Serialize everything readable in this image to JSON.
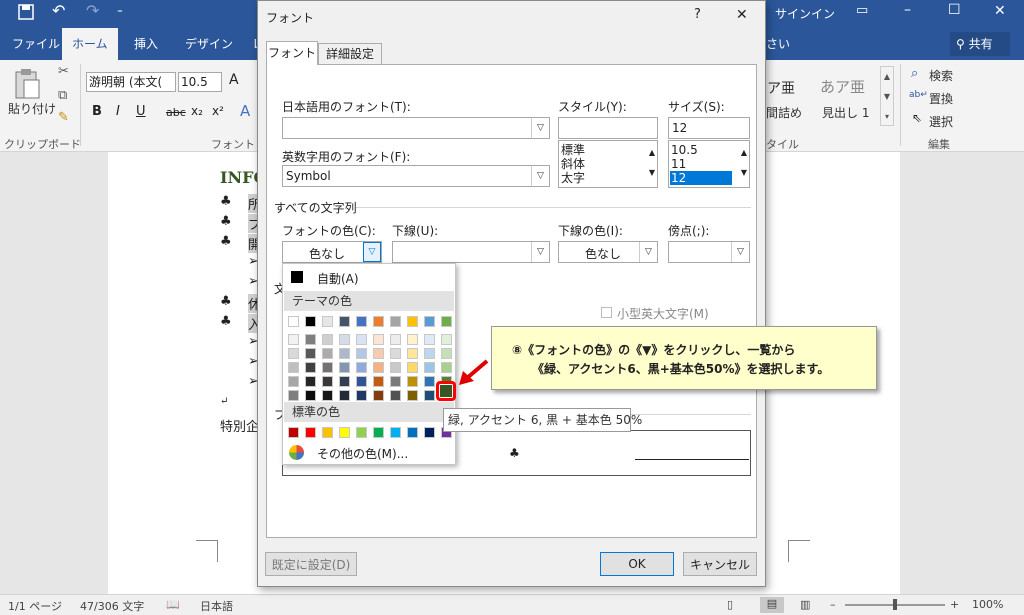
{
  "window": {
    "signin": "サインイン",
    "share": "共有",
    "help_hint": "さい"
  },
  "tabs": [
    "ファイル",
    "ホーム",
    "挿入",
    "デザイン",
    "レ"
  ],
  "ribbon": {
    "paste": "貼り付け",
    "clipboard": "クリップボード",
    "font_group": "フォント",
    "font_name": "游明朝 (本文(",
    "font_size": "10.5",
    "style1_preview": "ア亜",
    "style1_name": "間詰め",
    "style2_preview": "あア亜",
    "style2_name": "見出し 1",
    "style_group": "タイル",
    "find": "検索",
    "replace": "置換",
    "select": "選択",
    "edit_group": "編集"
  },
  "doc": {
    "heading": "INFO",
    "bullet_chars": [
      "♣",
      "♣",
      "♣",
      "➢",
      "➢",
      "♣",
      "♣",
      "➢",
      "➢",
      "➢"
    ],
    "frag1": "所",
    "frag2": "プ",
    "frag3": "開",
    "frag4": "休",
    "frag5": "入",
    "return": "↵",
    "special": "特別企"
  },
  "status": {
    "page": "1/1 ページ",
    "words": "47/306 文字",
    "lang": "日本語",
    "zoom": "100%"
  },
  "dialog": {
    "title": "フォント",
    "help": "?",
    "close": "✕",
    "tab_font": "フォント",
    "tab_advanced": "詳細設定",
    "jp_font_label": "日本語用のフォント(T):",
    "jp_font_value": "",
    "en_font_label": "英数字用のフォント(F):",
    "en_font_value": "Symbol",
    "style_label": "スタイル(Y):",
    "style_value": "",
    "style_options": [
      "標準",
      "斜体",
      "太字"
    ],
    "size_label": "サイズ(S):",
    "size_value": "12",
    "size_options": [
      "10.5",
      "11",
      "12"
    ],
    "all_text_label": "すべての文字列",
    "font_color_label": "フォントの色(C):",
    "font_color_value": "色なし",
    "underline_label": "下線(U):",
    "underline_value": "",
    "underline_color_label": "下線の色(I):",
    "underline_color_value": "色なし",
    "emphasis_label": "傍点(;):",
    "emphasis_value": "",
    "effects_label": "文",
    "smallcaps_label": "小型英大文字(M)",
    "preview_label": "プ",
    "preview_char": "♣",
    "default_button": "既定に設定(D)",
    "ok_button": "OK",
    "cancel_button": "キャンセル"
  },
  "palette": {
    "auto_label": "自動(A)",
    "theme_label": "テーマの色",
    "standard_label": "標準の色",
    "more_label": "その他の色(M)...",
    "theme_top": [
      "#ffffff",
      "#000000",
      "#e7e6e6",
      "#44546a",
      "#4472c4",
      "#ed7d31",
      "#a5a5a5",
      "#ffc000",
      "#5b9bd5",
      "#70ad47"
    ],
    "theme_shades": [
      [
        "#f2f2f2",
        "#7f7f7f",
        "#d0cece",
        "#d6dce5",
        "#dae3f3",
        "#fbe5d6",
        "#ededed",
        "#fff2cc",
        "#deebf7",
        "#e2f0d9"
      ],
      [
        "#d9d9d9",
        "#595959",
        "#aeabab",
        "#adb9ca",
        "#b4c7e7",
        "#f8cbad",
        "#dbdbdb",
        "#ffe699",
        "#bdd7ee",
        "#c5e0b4"
      ],
      [
        "#bfbfbf",
        "#404040",
        "#757171",
        "#8497b0",
        "#8faadc",
        "#f4b183",
        "#c9c9c9",
        "#ffd966",
        "#9dc3e6",
        "#a9d18e"
      ],
      [
        "#a6a6a6",
        "#262626",
        "#3b3838",
        "#323f4f",
        "#2f5597",
        "#c55a11",
        "#7b7b7b",
        "#bf9000",
        "#2e75b6",
        "#548235"
      ],
      [
        "#7f7f7f",
        "#0d0d0d",
        "#171616",
        "#222a35",
        "#203864",
        "#843c0c",
        "#525252",
        "#7f6000",
        "#1f4e79",
        "#375623"
      ]
    ],
    "standard": [
      "#c00000",
      "#ff0000",
      "#ffc000",
      "#ffff00",
      "#92d050",
      "#00b050",
      "#00b0f0",
      "#0070c0",
      "#002060",
      "#7030a0"
    ]
  },
  "tooltip": "緑, アクセント 6, 黒 + 基本色 50%",
  "callout": {
    "line1": "⑧《フォントの色》の《▼》をクリックし、一覧から",
    "line2": "《緑、アクセント6、黒+基本色50%》を選択します。"
  }
}
